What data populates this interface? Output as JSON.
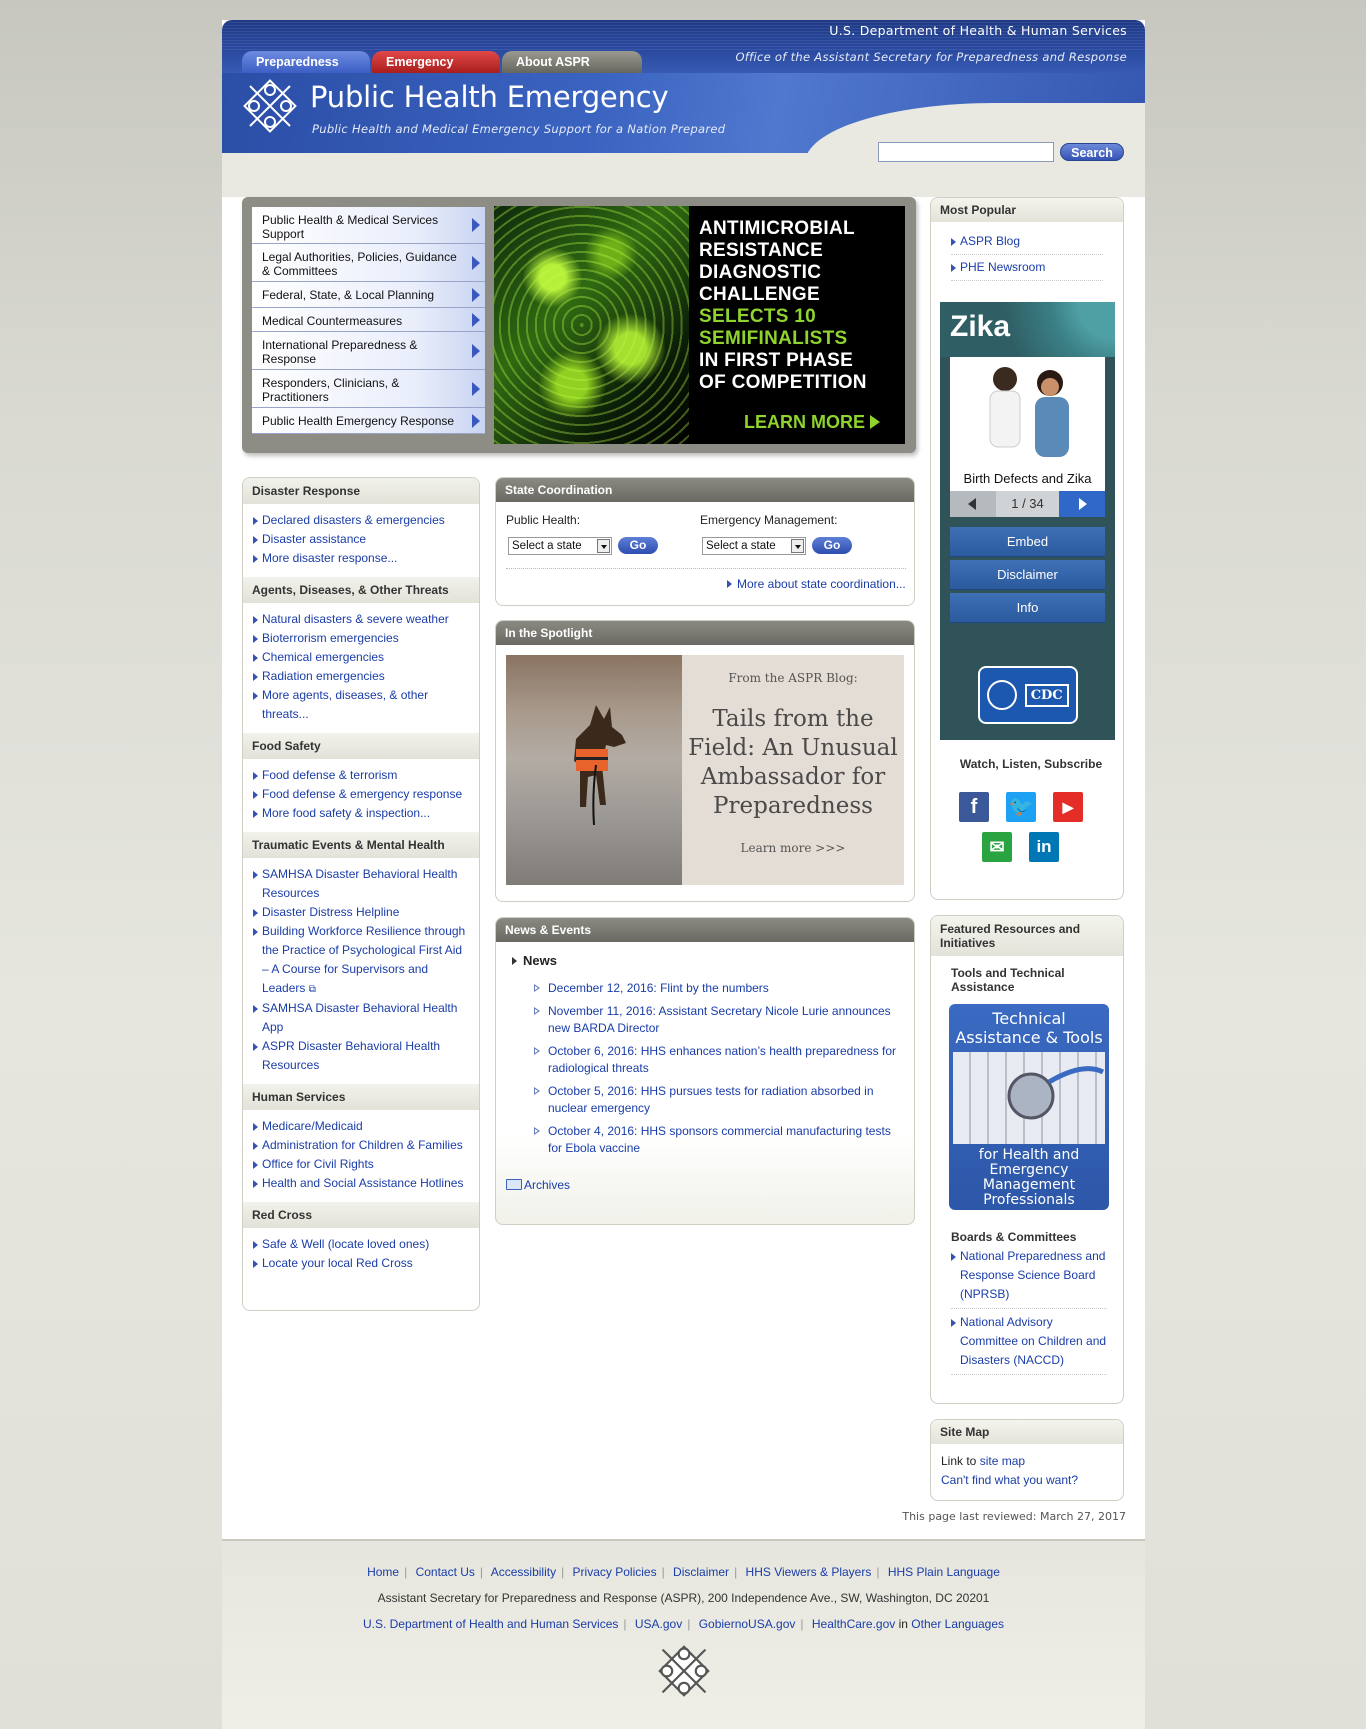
{
  "header": {
    "agency": "U.S. Department of Health & Human Services",
    "office": "Office of the Assistant Secretary for Preparedness and Response",
    "tabs": [
      "Preparedness",
      "Emergency",
      "About ASPR"
    ],
    "site_title": "Public Health Emergency",
    "site_tagline": "Public Health and Medical Emergency Support for a Nation Prepared",
    "search_button": "Search",
    "search_value": ""
  },
  "feature_nav": [
    "Public Health & Medical Services Support",
    "Legal Authorities, Policies, Guidance & Committees",
    "Federal, State, & Local Planning",
    "Medical Countermeasures",
    "International Preparedness & Response",
    "Responders, Clinicians, & Practitioners",
    "Public Health Emergency Response"
  ],
  "promo": {
    "lines_white": [
      "ANTIMICROBIAL",
      "RESISTANCE",
      "DIAGNOSTIC",
      "CHALLENGE"
    ],
    "lines_green": [
      "SELECTS 10",
      "SEMIFINALISTS"
    ],
    "lines_white2": [
      "IN FIRST PHASE",
      "OF COMPETITION"
    ],
    "cta": "LEARN MORE"
  },
  "left_sidebar": {
    "disaster_response": {
      "title": "Disaster Response",
      "links": [
        "Declared disasters & emergencies",
        "Disaster assistance",
        "More disaster response..."
      ]
    },
    "agents": {
      "title": "Agents, Diseases, & Other Threats",
      "links": [
        "Natural disasters & severe weather",
        "Bioterrorism emergencies",
        "Chemical emergencies",
        "Radiation emergencies",
        "More agents, diseases, & other threats..."
      ]
    },
    "food": {
      "title": "Food Safety",
      "links": [
        "Food defense & terrorism",
        "Food defense & emergency response",
        "More food safety & inspection..."
      ]
    },
    "traumatic": {
      "title": "Traumatic Events & Mental Health",
      "links": [
        "SAMHSA Disaster Behavioral Health Resources",
        "Disaster Distress Helpline",
        "Building Workforce Resilience through the Practice of Psychological First Aid – A Course for Supervisors and Leaders",
        "SAMHSA Disaster Behavioral Health App",
        "ASPR Disaster Behavioral Health Resources"
      ]
    },
    "human": {
      "title": "Human Services",
      "links": [
        "Medicare/Medicaid",
        "Administration for Children & Families",
        "Office for Civil Rights",
        "Health and Social Assistance Hotlines"
      ]
    },
    "redcross": {
      "title": "Red Cross",
      "links": [
        "Safe & Well (locate loved ones)",
        "Locate your local Red Cross"
      ]
    }
  },
  "state_coordination": {
    "title": "State Coordination",
    "public_health_label": "Public Health:",
    "emergency_label": "Emergency Management:",
    "select_value": "Select a state",
    "go": "Go",
    "more": "More about state coordination..."
  },
  "spotlight": {
    "title": "In the Spotlight",
    "from": "From the ASPR Blog:",
    "headline": "Tails from the Field: An Unusual Ambassador for Preparedness",
    "learn": "Learn more >>>"
  },
  "news": {
    "title": "News & Events",
    "subtitle": "News",
    "items": [
      "December 12, 2016: Flint by the numbers",
      "November 11, 2016: Assistant Secretary Nicole Lurie announces new BARDA Director",
      "October 6, 2016: HHS enhances nation’s health preparedness for radiological threats",
      "October 5, 2016: HHS pursues tests for radiation absorbed in nuclear emergency",
      "October 4, 2016: HHS sponsors commercial manufacturing tests for Ebola vaccine"
    ],
    "archives": "Archives"
  },
  "most_popular": {
    "title": "Most Popular",
    "links": [
      "ASPR Blog",
      "PHE Newsroom"
    ]
  },
  "zika_widget": {
    "title": "Zika",
    "caption": "Birth Defects and Zika",
    "pager": "1 / 34",
    "buttons": [
      "Embed",
      "Disclaimer",
      "Info"
    ],
    "cdc": "CDC"
  },
  "social": {
    "title": "Watch, Listen, Subscribe"
  },
  "featured": {
    "title": "Featured Resources and Initiatives",
    "tools_title": "Tools and Technical Assistance",
    "ta_top": "Technical Assistance & Tools",
    "ta_bottom": "for Health and Emergency Management Professionals",
    "boards_title": "Boards & Committees",
    "boards": [
      "National Preparedness and Response Science Board (NPRSB)",
      "National Advisory Committee on Children and Disasters (NACCD)"
    ]
  },
  "sitemap": {
    "title": "Site Map",
    "link_prefix": "Link to ",
    "link": "site map",
    "cant_find": "Can't find what you want?"
  },
  "last_reviewed": "This page last reviewed: March 27, 2017",
  "footer": {
    "links1": [
      "Home",
      "Contact Us",
      "Accessibility",
      "Privacy Policies",
      "Disclaimer",
      "HHS Viewers & Players",
      "HHS Plain Language"
    ],
    "address": "Assistant Secretary for Preparedness and Response (ASPR), 200 Independence Ave., SW, Washington, DC 20201",
    "links2": [
      "U.S. Department of Health and Human Services",
      "USA.gov",
      "GobiernoUSA.gov",
      "HealthCare.gov"
    ],
    "in_text": " in ",
    "other_languages": "Other Languages"
  }
}
